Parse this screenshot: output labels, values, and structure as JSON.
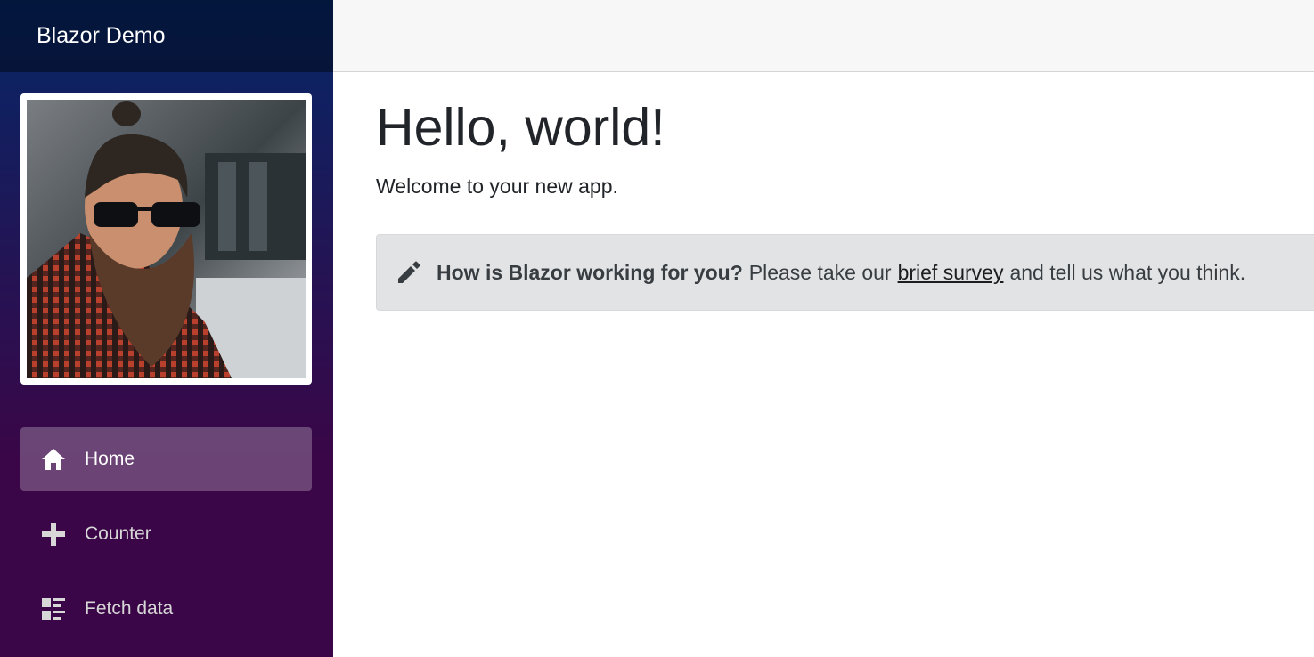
{
  "brand": {
    "title": "Blazor Demo"
  },
  "nav": {
    "items": [
      {
        "label": "Home",
        "icon": "home-icon",
        "active": true
      },
      {
        "label": "Counter",
        "icon": "plus-icon",
        "active": false
      },
      {
        "label": "Fetch data",
        "icon": "list-rich-icon",
        "active": false
      }
    ]
  },
  "main": {
    "heading": "Hello, world!",
    "welcome": "Welcome to your new app.",
    "survey": {
      "icon": "pencil-icon",
      "prompt": "How is Blazor working for you?",
      "text_before": "Please take our",
      "link": "brief survey",
      "text_after": "and tell us what you think."
    }
  },
  "colors": {
    "sidebar_top": "#052767",
    "sidebar_bottom": "#3a0647",
    "alert_bg": "#e2e3e5"
  }
}
